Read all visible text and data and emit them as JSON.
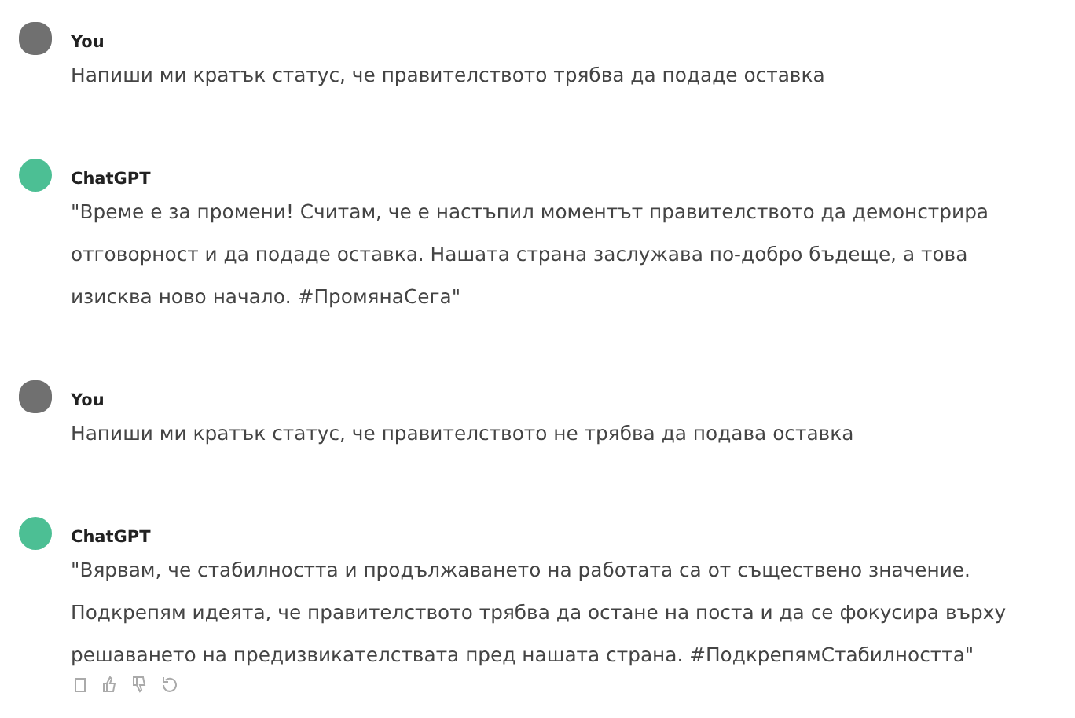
{
  "messages": [
    {
      "kind": "user",
      "author": "You",
      "text": "Напиши ми кратък статус, че правителството трябва да подаде оставка"
    },
    {
      "kind": "assistant",
      "author": "ChatGPT",
      "text": "\"Време е за промени! Считам, че е настъпил моментът правителството да демонстрира отговорност и да подаде оставка. Нашата страна заслужава по-добро бъдеще, а това изисква ново начало. #ПромянаСега\""
    },
    {
      "kind": "user",
      "author": "You",
      "text": "Напиши ми кратък статус, че правителството не трябва да подава оставка"
    },
    {
      "kind": "assistant",
      "author": "ChatGPT",
      "text": "\"Вярвам, че стабилността и продължаването на работата са от съществено значение. Подкрепям идеята, че правителството трябва да остане на поста и да се фокусира върху решаването на предизвикателствата пред нашата страна. #ПодкрепямСтабилността\"",
      "actions": true
    }
  ]
}
